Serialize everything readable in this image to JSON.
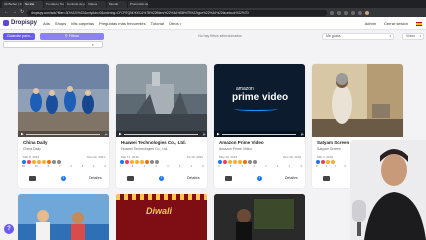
{
  "browser": {
    "tabs": [
      {
        "title": "(9) Bieber | Facebook",
        "active": false
      },
      {
        "title": "No title",
        "active": true
      },
      {
        "title": "Tu video | Technologies",
        "active": false
      },
      {
        "title": "Controle de pedidos",
        "active": false
      },
      {
        "title": "Videos",
        "active": false
      },
      {
        "title": "Mundo",
        "active": false
      },
      {
        "title": "Promoción de ventas",
        "active": false
      }
    ],
    "url": "dropispy.com/ads?filter=3D%220%22&onlyAds=0&ordering=CFCFEQNDKKC&%7B%22filters%22%3A%5B%7B%22type%22%3A%22facebook%22%7D"
  },
  "header": {
    "logo": "Dropispy",
    "nav": [
      {
        "label": "Ads",
        "has_menu": false
      },
      {
        "label": "Shops",
        "has_menu": false
      },
      {
        "label": "Mis carpetas",
        "has_menu": false
      },
      {
        "label": "Preguntas más frecuentes",
        "has_menu": false
      },
      {
        "label": "Tutorial",
        "has_menu": false
      },
      {
        "label": "Otros",
        "has_menu": true
      }
    ],
    "right": {
      "account": "Admin",
      "logout": "Cerrar sesión"
    }
  },
  "filters": {
    "saved_filters_label": "Guardar para...",
    "filters_button": "Filtros",
    "no_filters_text": "No hay filtros seleccionados",
    "sort_select": "Me gusta",
    "type_select": "Vídeo",
    "search_placeholder": ""
  },
  "cards": [
    {
      "name": "China Daily",
      "subtitle": "China Daily",
      "start_date": "Mar 8, 2019",
      "end_date": "Dec 22, 2021",
      "reaction_counts": [
        "28",
        "16",
        "9",
        "7",
        "3",
        "5",
        "1",
        "0"
      ],
      "detail_label": "Detalles",
      "thumb_colors": [
        "#7c8ba3",
        "#1d5fb6"
      ]
    },
    {
      "name": "Huawei Technologies Co., Ltd.",
      "subtitle": "Huawei Technologies Co., Ltd.",
      "start_date": "Mar 17, 2019",
      "end_date": "Jul 19, 2022",
      "reaction_counts": [
        "7",
        "6",
        "1",
        "2",
        "4",
        "3",
        "1",
        "0"
      ],
      "detail_label": "Detalles",
      "thumb_colors": [
        "#48525c",
        "#a7b0b5"
      ]
    },
    {
      "name": "Amazon Prime Video",
      "subtitle": "Amazon Prime Video",
      "start_date": "May 20, 2019",
      "end_date": "Dec 30, 2019",
      "reaction_counts": [
        "3",
        "6",
        "1",
        "3",
        "2",
        "4",
        "1",
        "3"
      ],
      "detail_label": "Detalles",
      "thumb_colors": [
        "#0c1b2e",
        "#172c48"
      ],
      "thumb_text_small": "amazon",
      "thumb_text_big": "prime video"
    },
    {
      "name": "Satyam Screen",
      "subtitle": "Satyam Screen",
      "start_date": "Mar 4, 2019",
      "end_date": "",
      "reaction_counts": [
        "3",
        "1",
        "1",
        "0"
      ],
      "detail_label": "Detalles",
      "thumb_colors": [
        "#6b5a46",
        "#d8c7a5"
      ]
    }
  ],
  "cards_row2": [
    {
      "thumb_colors": [
        "#2e6fb5",
        "#e8b98a"
      ]
    },
    {
      "thumb_colors": [
        "#7e0d14",
        "#c41a26"
      ],
      "thumb_text": "Diwali"
    },
    {
      "thumb_colors": [
        "#1a1a1a",
        "#3a4a2a"
      ]
    },
    {
      "thumb_colors": [
        "#e8e4dc",
        "#cfc7b8"
      ]
    }
  ],
  "help_button": "?"
}
